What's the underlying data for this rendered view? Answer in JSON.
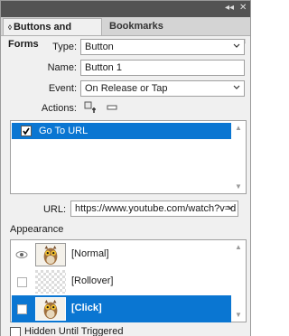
{
  "panel": {
    "collapse_glyph": "◂◂",
    "close_glyph": "✕",
    "menu_glyph": "▾≡"
  },
  "tabs": [
    {
      "label": "Buttons and Forms",
      "chevron": "◊",
      "active": true
    },
    {
      "label": "Bookmarks",
      "active": false
    }
  ],
  "form": {
    "type_label": "Type:",
    "type_value": "Button",
    "name_label": "Name:",
    "name_value": "Button 1",
    "event_label": "Event:",
    "event_value": "On Release or Tap",
    "actions_label": "Actions:"
  },
  "actions_list": [
    {
      "label": "Go To URL",
      "checked": true,
      "selected": true
    }
  ],
  "url": {
    "label": "URL:",
    "value": "https://www.youtube.com/watch?v=d"
  },
  "appearance": {
    "label": "Appearance",
    "states": [
      {
        "label": "[Normal]",
        "visible": true,
        "selected": false
      },
      {
        "label": "[Rollover]",
        "visible": false,
        "selected": false
      },
      {
        "label": "[Click]",
        "visible": false,
        "selected": true
      }
    ]
  },
  "hidden_until_triggered": {
    "label": "Hidden Until Triggered",
    "checked": false
  },
  "colors": {
    "selection": "#0a76d2",
    "titlebar": "#535353"
  },
  "icons": [
    "collapse-icon",
    "close-icon",
    "panel-menu-icon",
    "add-action-icon",
    "remove-action-icon",
    "chevron-down-icon",
    "eye-icon",
    "owl-thumbnail"
  ]
}
